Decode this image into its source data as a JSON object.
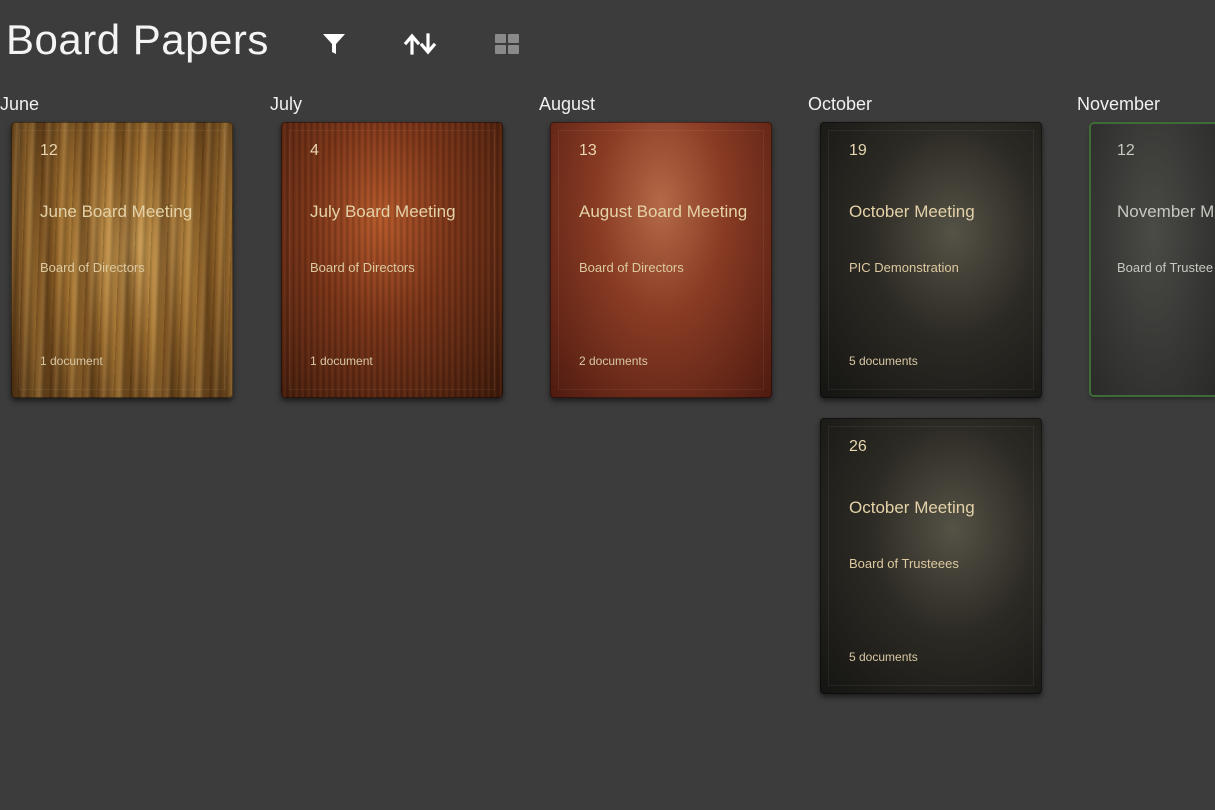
{
  "app": {
    "title": "Board Papers"
  },
  "toolbar": {
    "filter_icon": "filter-icon",
    "sort_icon": "sort-icon",
    "grid_icon": "grid-view-icon"
  },
  "columns": [
    {
      "month": "June",
      "cards": [
        {
          "day": "12",
          "title": "June Board Meeting",
          "subtitle": "Board of Directors",
          "count": "1 document",
          "texture": "wood-light"
        }
      ]
    },
    {
      "month": "July",
      "cards": [
        {
          "day": "4",
          "title": "July Board Meeting",
          "subtitle": "Board of Directors",
          "count": "1 document",
          "texture": "wood-dark"
        }
      ]
    },
    {
      "month": "August",
      "cards": [
        {
          "day": "13",
          "title": "August Board Meeting",
          "subtitle": "Board of Directors",
          "count": "2 documents",
          "texture": "leather-red"
        }
      ]
    },
    {
      "month": "October",
      "cards": [
        {
          "day": "19",
          "title": "October Meeting",
          "subtitle": "PIC Demonstration",
          "count": "5 documents",
          "texture": "leather-black"
        },
        {
          "day": "26",
          "title": "October Meeting",
          "subtitle": "Board of Trusteees",
          "count": "5 documents",
          "texture": "leather-black"
        }
      ]
    },
    {
      "month": "November",
      "cards": [
        {
          "day": "12",
          "title": "November M",
          "subtitle": "Board of Trustee",
          "count": "",
          "texture": "green-frame"
        }
      ]
    }
  ],
  "colors": {
    "background": "#3c3c3c",
    "card_text": "#e4d2a8",
    "accent_frame": "#3f6b38"
  }
}
